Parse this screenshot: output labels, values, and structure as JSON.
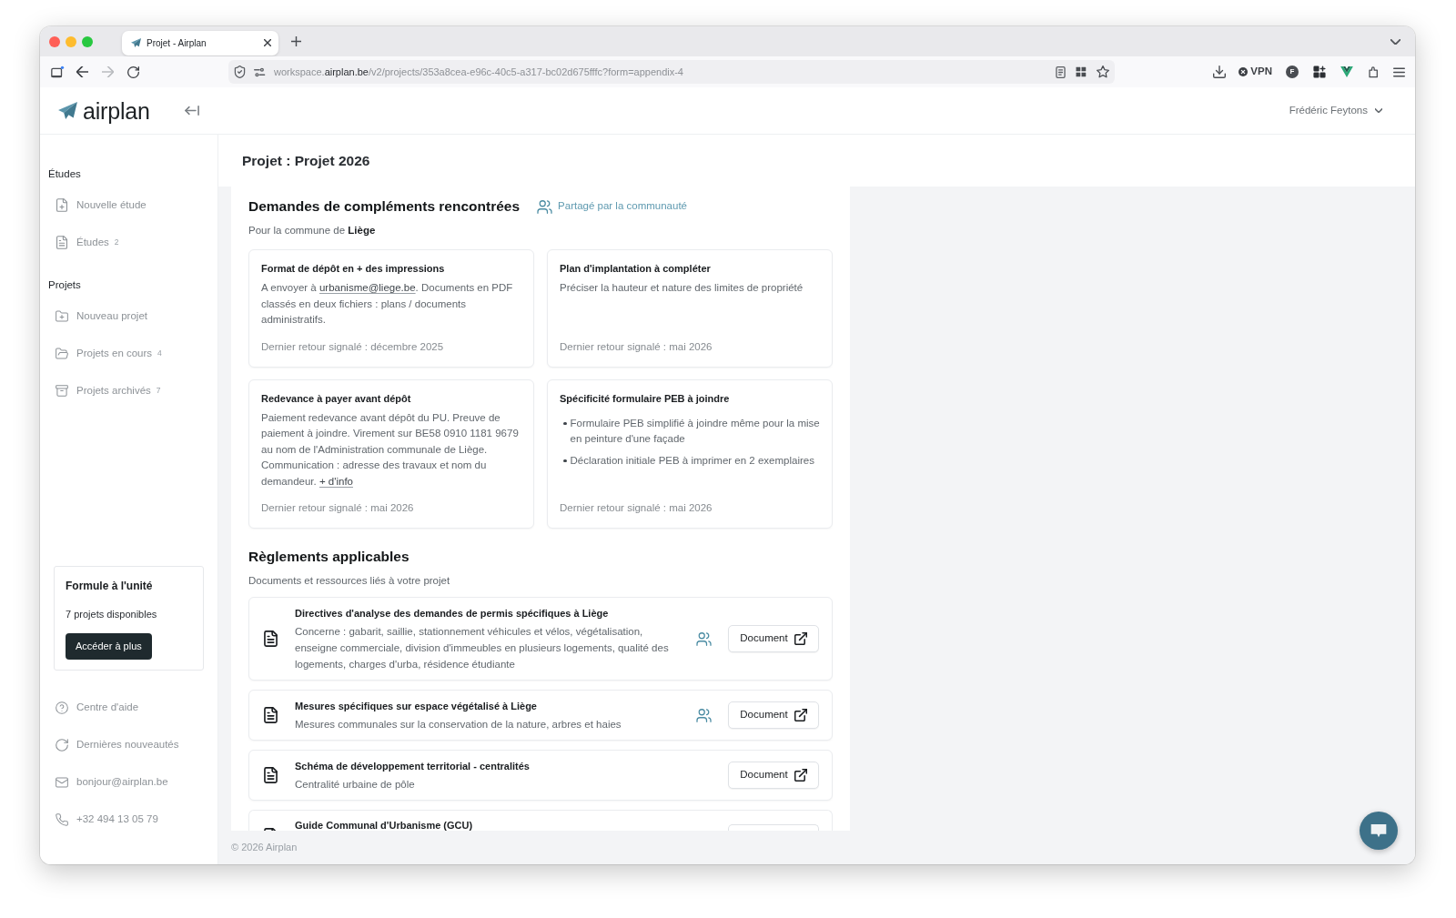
{
  "browser": {
    "tab": {
      "title": "Projet - Airplan"
    },
    "forward_enabled": false,
    "url": "workspace.**airplan.be**/v2/projects/353a8cea-e96c-40c5-a317-bc02d675fffc?form=appendix-4",
    "vpn": "VPN",
    "account_initial": "F"
  },
  "app": {
    "logo": "airplan",
    "user": "Frédéric Feytons",
    "sidebar": {
      "sections": [
        {
          "kind": "study",
          "title": "Études",
          "items": [
            {
              "kind": "create",
              "label": "Nouvelle étude",
              "selected": false
            },
            {
              "kind": "list",
              "label": "Études",
              "count": "2",
              "selected": false
            }
          ]
        },
        {
          "kind": "project",
          "title": "Projets",
          "items": [
            {
              "kind": "create",
              "label": "Nouveau projet",
              "selected": false
            },
            {
              "kind": "current",
              "label": "Projets en cours",
              "count": "4",
              "selected": false
            },
            {
              "kind": "archive",
              "label": "Projets archivés",
              "count": "7",
              "selected": false
            }
          ]
        }
      ],
      "plan": {
        "title": "Formule à l'unité",
        "text": "7 projets disponibles",
        "button": "Accéder à plus"
      },
      "links": [
        {
          "kind": "help",
          "label": "Centre d'aide"
        },
        {
          "kind": "news",
          "label": "Dernières nouveautés"
        },
        {
          "kind": "email",
          "label": "bonjour@airplan.be"
        },
        {
          "kind": "phone",
          "label": "+32 494 13 05 79"
        }
      ]
    },
    "page_title": "Projet : Projet 2026",
    "requests": {
      "title": "Demandes de compléments rencontrées",
      "shared_label": "Partagé par la communauté",
      "subtitle": "Pour la commune de **Liège**",
      "cards": [
        {
          "kind": "paragraph",
          "title": "Format de dépôt en + des impressions",
          "body": [
            {
              "kind": "text",
              "text": "A envoyer à "
            },
            {
              "kind": "link",
              "text": "urbanisme@liege.be"
            },
            {
              "kind": "text",
              "text": ". Documents en PDF classés en deux fichiers : plans / documents administratifs."
            }
          ],
          "footnote": "Dernier retour signalé : décembre 2025"
        },
        {
          "kind": "paragraph",
          "title": "Plan d'implantation à compléter",
          "body": [
            {
              "kind": "text",
              "text": "Préciser la hauteur et nature des limites de propriété"
            }
          ],
          "footnote": "Dernier retour signalé : mai 2026"
        },
        {
          "kind": "paragraph",
          "title": "Redevance à payer avant dépôt",
          "body": [
            {
              "kind": "text",
              "text": "Paiement redevance avant dépôt du PU. Preuve de paiement à joindre. Virement sur BE58 0910 1181 9679 au nom de l'Administration communale de Liège. Communication : adresse des travaux et nom du demandeur. "
            },
            {
              "kind": "link",
              "text": "+ d'info"
            }
          ],
          "footnote": "Dernier retour signalé : mai 2026"
        },
        {
          "kind": "bullets",
          "title": "Spécificité formulaire PEB à joindre",
          "bullets": [
            "Formulaire PEB simplifié à joindre même pour la mise en peinture d'une façade",
            "Déclaration initiale PEB à imprimer en 2 exemplaires"
          ],
          "footnote": "Dernier retour signalé : mai 2026"
        }
      ]
    },
    "regulations": {
      "title": "Règlements applicables",
      "subtitle": "Documents et ressources liés à votre projet",
      "documents": [
        {
          "title": "Directives d'analyse des demandes de permis spécifiques à Liège",
          "description": "Concerne : gabarit, saillie, stationnement véhicules et vélos, végétalisation, enseigne commerciale, division d'immeubles en plusieurs logements, qualité des logements, charges d'urba, résidence étudiante",
          "shared": true,
          "button": "Document",
          "clipped": false
        },
        {
          "title": "Mesures spécifiques sur espace végétalisé à Liège",
          "description": "Mesures communales sur la conservation de la nature, arbres et haies",
          "shared": true,
          "button": "Document",
          "clipped": false
        },
        {
          "title": "Schéma de développement territorial - centralités",
          "description": "Centralité urbaine de pôle",
          "shared": false,
          "button": "Document",
          "clipped": false
        },
        {
          "title": "Guide Communal d'Urbanisme (GCU)",
          "clipped": true
        }
      ]
    },
    "footer": "© 2026 Airplan"
  }
}
